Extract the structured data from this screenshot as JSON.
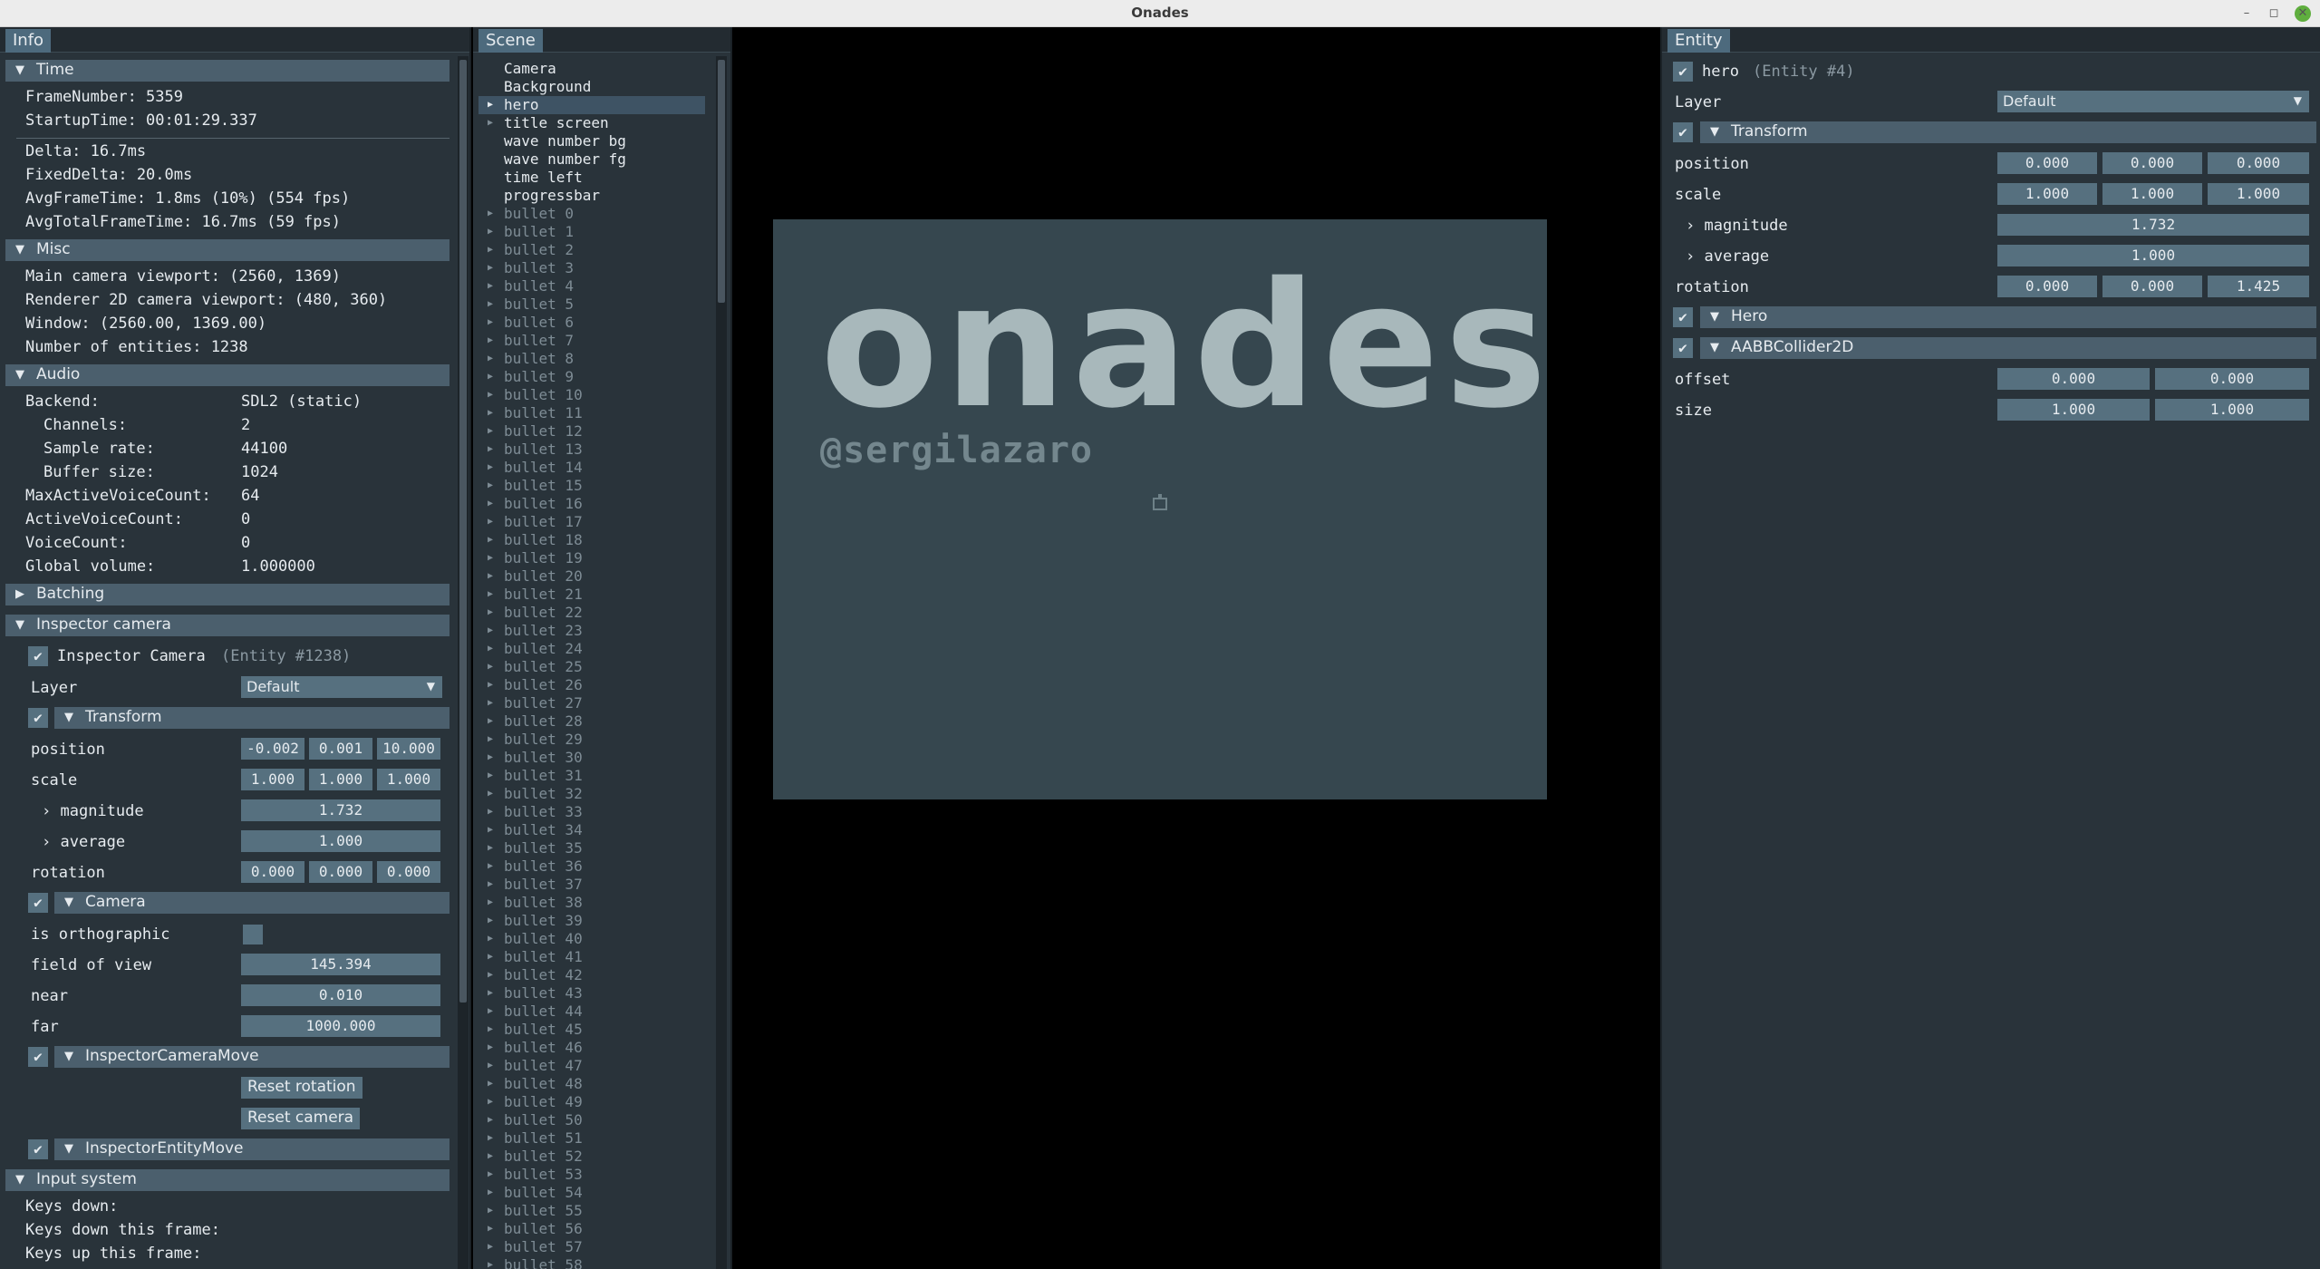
{
  "window": {
    "title": "Onades",
    "min": "–",
    "max": "◻",
    "close": "✕"
  },
  "info": {
    "tab": "Info",
    "time": {
      "header": "Time",
      "frame_number": "FrameNumber: 5359",
      "startup_time": "StartupTime: 00:01:29.337",
      "delta": "Delta: 16.7ms",
      "fixed_delta": "FixedDelta: 20.0ms",
      "avg_frame": "AvgFrameTime: 1.8ms (10%) (554 fps)",
      "avg_total": "AvgTotalFrameTime: 16.7ms (59 fps)"
    },
    "misc": {
      "header": "Misc",
      "main_viewport": "Main camera viewport: (2560, 1369)",
      "renderer_viewport": "Renderer 2D camera viewport: (480, 360)",
      "window": "Window: (2560.00, 1369.00)",
      "entities": "Number of entities: 1238"
    },
    "audio": {
      "header": "Audio",
      "rows": [
        {
          "label": "Backend:",
          "value": "SDL2 (static)",
          "indent": false
        },
        {
          "label": "Channels:",
          "value": "2",
          "indent": true
        },
        {
          "label": "Sample rate:",
          "value": "44100",
          "indent": true
        },
        {
          "label": "Buffer size:",
          "value": "1024",
          "indent": true
        },
        {
          "label": "MaxActiveVoiceCount:",
          "value": "64",
          "indent": false
        },
        {
          "label": "ActiveVoiceCount:",
          "value": "0",
          "indent": false
        },
        {
          "label": "VoiceCount:",
          "value": "0",
          "indent": false
        },
        {
          "label": "Global volume:",
          "value": "1.000000",
          "indent": false
        }
      ]
    },
    "batching": {
      "header": "Batching"
    },
    "inspector_camera": {
      "header": "Inspector camera",
      "entity_name": "Inspector Camera",
      "entity_id": "(Entity #1238)",
      "layer_label": "Layer",
      "layer_value": "Default",
      "transform_header": "Transform",
      "position_label": "position",
      "position": [
        "-0.002",
        "0.001",
        "10.000"
      ],
      "scale_label": "scale",
      "scale": [
        "1.000",
        "1.000",
        "1.000"
      ],
      "magnitude_label": "magnitude",
      "magnitude": "1.732",
      "average_label": "average",
      "average": "1.000",
      "rotation_label": "rotation",
      "rotation": [
        "0.000",
        "0.000",
        "0.000"
      ],
      "camera_header": "Camera",
      "ortho_label": "is orthographic",
      "fov_label": "field of view",
      "fov": "145.394",
      "near_label": "near",
      "near": "0.010",
      "far_label": "far",
      "far": "1000.000",
      "camera_move_header": "InspectorCameraMove",
      "reset_rotation": "Reset rotation",
      "reset_camera": "Reset camera",
      "entity_move_header": "InspectorEntityMove"
    },
    "input": {
      "header": "Input system",
      "keys_down": "Keys down:",
      "keys_down_frame": "Keys down this frame:",
      "keys_up_frame": "Keys up this frame:"
    }
  },
  "scene": {
    "tab": "Scene",
    "items": [
      "Camera",
      "Background",
      "hero",
      "title screen",
      "wave number bg",
      "wave number fg",
      "time left",
      "progressbar"
    ],
    "bullets": [
      "bullet 0",
      "bullet 1",
      "bullet 2",
      "bullet 3",
      "bullet 4",
      "bullet 5",
      "bullet 6",
      "bullet 7",
      "bullet 8",
      "bullet 9",
      "bullet 10",
      "bullet 11",
      "bullet 12",
      "bullet 13",
      "bullet 14",
      "bullet 15",
      "bullet 16",
      "bullet 17",
      "bullet 18",
      "bullet 19",
      "bullet 20",
      "bullet 21",
      "bullet 22",
      "bullet 23",
      "bullet 24",
      "bullet 25",
      "bullet 26",
      "bullet 27",
      "bullet 28",
      "bullet 29",
      "bullet 30",
      "bullet 31",
      "bullet 32",
      "bullet 33",
      "bullet 34",
      "bullet 35",
      "bullet 36",
      "bullet 37",
      "bullet 38",
      "bullet 39",
      "bullet 40",
      "bullet 41",
      "bullet 42",
      "bullet 43",
      "bullet 44",
      "bullet 45",
      "bullet 46",
      "bullet 47",
      "bullet 48",
      "bullet 49",
      "bullet 50",
      "bullet 51",
      "bullet 52",
      "bullet 53",
      "bullet 54",
      "bullet 55",
      "bullet 56",
      "bullet 57",
      "bullet 58"
    ]
  },
  "game": {
    "title": "onades",
    "author": "@sergilazaro"
  },
  "entity": {
    "tab": "Entity",
    "name": "hero",
    "id": "(Entity #4)",
    "layer_label": "Layer",
    "layer_value": "Default",
    "transform_header": "Transform",
    "position_label": "position",
    "position": [
      "0.000",
      "0.000",
      "0.000"
    ],
    "scale_label": "scale",
    "scale": [
      "1.000",
      "1.000",
      "1.000"
    ],
    "magnitude_label": "magnitude",
    "magnitude": "1.732",
    "average_label": "average",
    "average": "1.000",
    "rotation_label": "rotation",
    "rotation": [
      "0.000",
      "0.000",
      "1.425"
    ],
    "hero_header": "Hero",
    "collider_header": "AABBCollider2D",
    "offset_label": "offset",
    "offset": [
      "0.000",
      "0.000"
    ],
    "size_label": "size",
    "size": [
      "1.000",
      "1.000"
    ]
  },
  "colors": {
    "panel": "#29333a",
    "header": "#4b5f6d",
    "field": "#56707f",
    "tab": "#4d6a7d",
    "game_bg": "#36474f",
    "game_text": "#a8b8bb"
  },
  "icons": {
    "collapse": "triangle-down-icon",
    "expand": "triangle-right-icon",
    "check": "check-icon"
  }
}
